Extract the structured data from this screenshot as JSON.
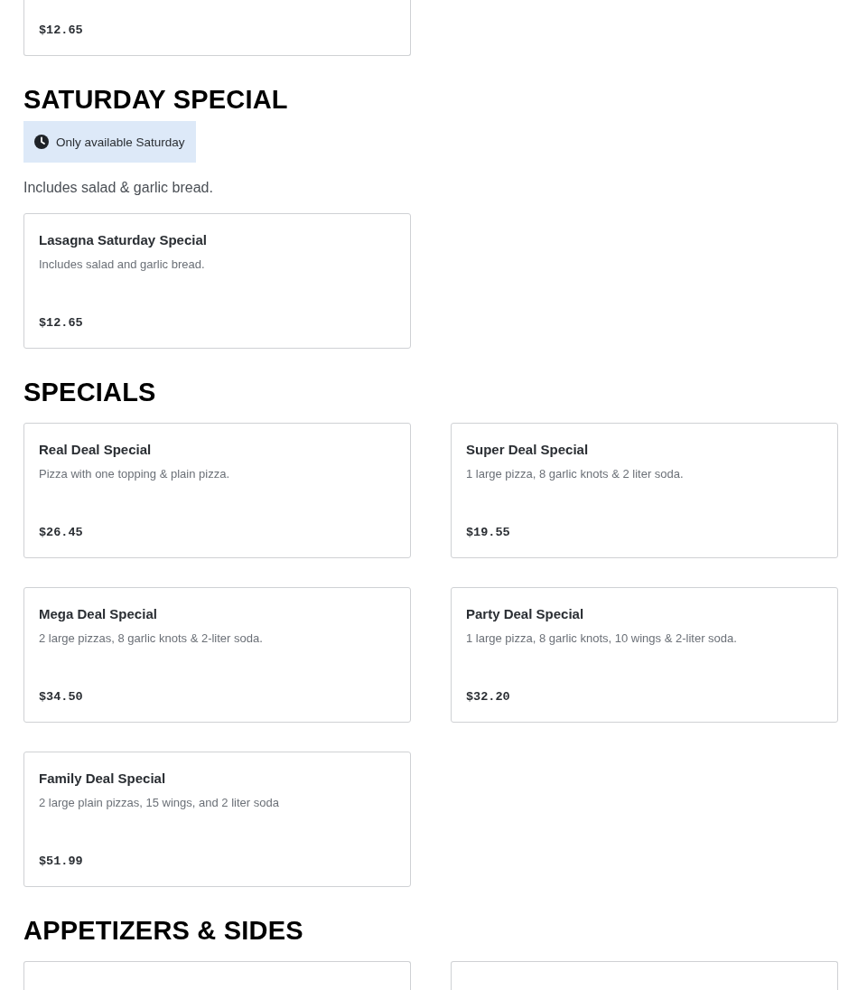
{
  "sections": [
    {
      "items": [
        {
          "kind": "cut_top",
          "price": "$12.65"
        }
      ]
    },
    {
      "title": "SATURDAY SPECIAL",
      "badge": "Only available Saturday",
      "description": "Includes salad & garlic bread.",
      "items": [
        {
          "name": "Lasagna Saturday Special",
          "description": "Includes salad and garlic bread.",
          "price": "$12.65"
        }
      ]
    },
    {
      "title": "SPECIALS",
      "items": [
        {
          "name": "Real Deal Special",
          "description": "Pizza with one topping & plain pizza.",
          "price": "$26.45"
        },
        {
          "name": "Super Deal Special",
          "description": "1 large pizza, 8 garlic knots & 2 liter soda.",
          "price": "$19.55"
        },
        {
          "name": "Mega Deal Special",
          "description": "2 large pizzas, 8 garlic knots & 2-liter soda.",
          "price": "$34.50"
        },
        {
          "name": "Party Deal Special",
          "description": "1 large pizza, 8 garlic knots, 10 wings & 2-liter soda.",
          "price": "$32.20"
        },
        {
          "name": "Family Deal Special",
          "description": "2 large plain pizzas, 15 wings, and 2 liter soda",
          "price": "$51.99"
        }
      ]
    },
    {
      "title": "APPETIZERS & SIDES",
      "items": [
        {
          "kind": "cut_bottom"
        },
        {
          "kind": "cut_bottom"
        }
      ]
    }
  ]
}
